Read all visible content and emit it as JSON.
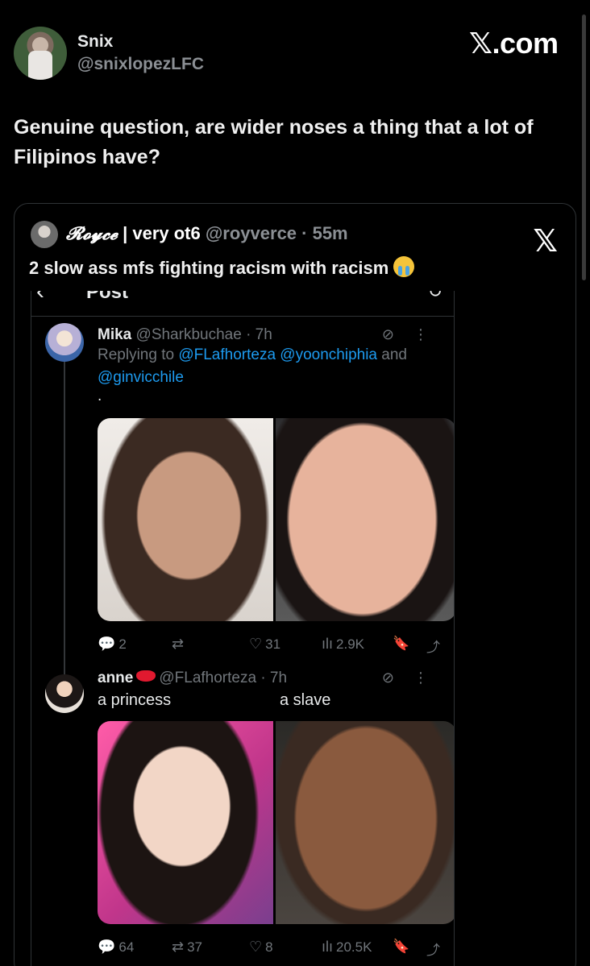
{
  "post": {
    "author_name": "Snix",
    "author_handle": "@snixlopezLFC",
    "site_mark": "𝕏.com",
    "text": "Genuine question, are wider noses a thing that a lot of Filipinos have?"
  },
  "quote": {
    "author_name": "𝓡𝓸𝔂𝓬𝓮",
    "author_sub": " | very ot6 ",
    "handle_time": "@royverce · 55m",
    "x_logo": "𝕏",
    "text": "2 slow ass mfs fighting racism with racism"
  },
  "embedded": {
    "back_glyph": "‹",
    "title": "Post",
    "refresh_glyph": "↻",
    "replies": [
      {
        "name": "Mika",
        "handle_time": "@Sharkbuchae · 7h",
        "replying_prefix": "Replying to ",
        "mentions": "@FLafhorteza @yoonchiphia",
        "and_text": " and ",
        "mention2": "@ginvicchile",
        "body": ".",
        "icons": "⊘⋮",
        "stats": {
          "reply": "2",
          "repost": "",
          "like": "31",
          "views": "2.9K"
        }
      },
      {
        "name": "anne",
        "handle_time": "@FLafhorteza · 7h",
        "icons": "⊘⋮",
        "caption_left": "a princess",
        "caption_right": "a slave",
        "stats": {
          "reply": "64",
          "repost": "37",
          "like": "8",
          "views": "20.5K"
        }
      }
    ]
  },
  "icons": {
    "reply": "💬",
    "repost": "⇄",
    "like": "♡",
    "views": "ılı",
    "bookmark": "🔖",
    "share": "⤴"
  }
}
